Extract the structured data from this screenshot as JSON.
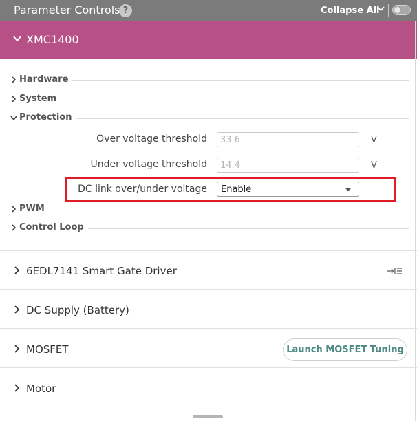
{
  "header": {
    "title": "Parameter Controls",
    "help_glyph": "?",
    "collapse_all_label": "Collapse All",
    "collapse_chevron": "⌄"
  },
  "device": {
    "name": "XMC1400"
  },
  "subsections": [
    {
      "label": "Hardware",
      "expanded": false
    },
    {
      "label": "System",
      "expanded": false
    },
    {
      "label": "Protection",
      "expanded": true
    },
    {
      "label": "PWM",
      "expanded": false
    },
    {
      "label": "Control Loop",
      "expanded": false
    }
  ],
  "protection": {
    "over_voltage": {
      "label": "Over voltage threshold",
      "value": "33.6",
      "unit": "V"
    },
    "under_voltage": {
      "label": "Under voltage threshold",
      "value": "14.4",
      "unit": "V"
    },
    "dc_link": {
      "label": "DC link over/under voltage",
      "value": "Enable"
    }
  },
  "sections": [
    {
      "label": "6EDL7141 Smart Gate Driver",
      "icon": "collapse-panel-icon"
    },
    {
      "label": "DC Supply (Battery)"
    },
    {
      "label": "MOSFET",
      "button_label": "Launch MOSFET Tuning"
    },
    {
      "label": "Motor"
    }
  ],
  "colors": {
    "topbar": "#7b7b7b",
    "device_header": "#b85088",
    "highlight": "#e01b24",
    "launch_text": "#4d8a83"
  }
}
